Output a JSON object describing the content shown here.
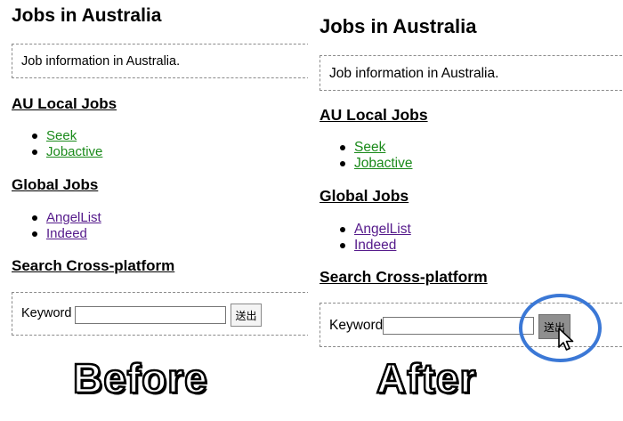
{
  "before": {
    "page_title": "Jobs in Australia",
    "info_text": "Job information in Australia.",
    "local_heading": "AU Local Jobs",
    "local_links": [
      "Seek",
      "Jobactive"
    ],
    "global_heading": "Global Jobs",
    "global_links": [
      "AngelList",
      "Indeed"
    ],
    "search_heading": "Search Cross-platform",
    "keyword_label": "Keyword",
    "keyword_value": "",
    "submit_label": "送出"
  },
  "after": {
    "page_title": "Jobs in Australia",
    "info_text": "Job information in Australia.",
    "local_heading": "AU Local Jobs",
    "local_links": [
      "Seek",
      "Jobactive"
    ],
    "global_heading": "Global Jobs",
    "global_links": [
      "AngelList",
      "Indeed"
    ],
    "search_heading": "Search Cross-platform",
    "keyword_label": "Keyword",
    "keyword_value": "",
    "submit_label": "送出"
  },
  "captions": {
    "before": "Before",
    "after": "After"
  },
  "colors": {
    "link_unvisited": "#1a8a1a",
    "link_visited": "#551a8b",
    "highlight_circle": "#3b78d6",
    "submit_hover_bg": "#8f8f8f"
  },
  "icons": {
    "cursor": "mouse-pointer-icon"
  }
}
